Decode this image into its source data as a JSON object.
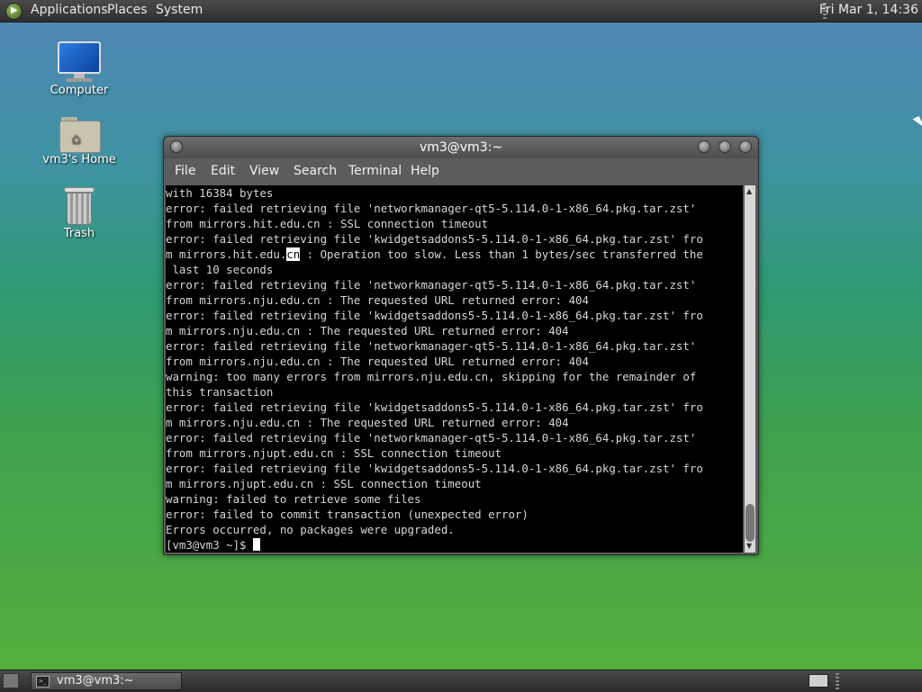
{
  "top_panel": {
    "menus": [
      "Applications",
      "Places",
      "System"
    ],
    "clock": "Fri Mar  1, 14:36"
  },
  "desktop_icons": [
    {
      "label": "Computer",
      "icon": "computer-icon"
    },
    {
      "label": "vm3's Home",
      "icon": "home-folder-icon"
    },
    {
      "label": "Trash",
      "icon": "trash-icon"
    }
  ],
  "terminal": {
    "title": "vm3@vm3:~",
    "menu": [
      "File",
      "Edit",
      "View",
      "Search",
      "Terminal",
      "Help"
    ],
    "lines": [
      "with 16384 bytes",
      "error: failed retrieving file 'networkmanager-qt5-5.114.0-1-x86_64.pkg.tar.zst'",
      "from mirrors.hit.edu.cn : SSL connection timeout",
      "error: failed retrieving file 'kwidgetsaddons5-5.114.0-1-x86_64.pkg.tar.zst' fro",
      "m mirrors.hit.edu.cn : Operation too slow. Less than 1 bytes/sec transferred the",
      " last 10 seconds",
      "error: failed retrieving file 'networkmanager-qt5-5.114.0-1-x86_64.pkg.tar.zst'",
      "from mirrors.nju.edu.cn : The requested URL returned error: 404",
      "error: failed retrieving file 'kwidgetsaddons5-5.114.0-1-x86_64.pkg.tar.zst' fro",
      "m mirrors.nju.edu.cn : The requested URL returned error: 404",
      "error: failed retrieving file 'networkmanager-qt5-5.114.0-1-x86_64.pkg.tar.zst'",
      "from mirrors.nju.edu.cn : The requested URL returned error: 404",
      "warning: too many errors from mirrors.nju.edu.cn, skipping for the remainder of",
      "this transaction",
      "error: failed retrieving file 'kwidgetsaddons5-5.114.0-1-x86_64.pkg.tar.zst' fro",
      "m mirrors.nju.edu.cn : The requested URL returned error: 404",
      "error: failed retrieving file 'networkmanager-qt5-5.114.0-1-x86_64.pkg.tar.zst'",
      "from mirrors.njupt.edu.cn : SSL connection timeout",
      "error: failed retrieving file 'kwidgetsaddons5-5.114.0-1-x86_64.pkg.tar.zst' fro",
      "m mirrors.njupt.edu.cn : SSL connection timeout",
      "warning: failed to retrieve some files",
      "error: failed to commit transaction (unexpected error)",
      "Errors occurred, no packages were upgraded."
    ],
    "highlight_line_index": 4,
    "highlight_text": "cn",
    "prompt": "[vm3@vm3 ~]$ "
  },
  "taskbar": {
    "window_button": "vm3@vm3:~",
    "window_icon": "terminal-icon"
  }
}
